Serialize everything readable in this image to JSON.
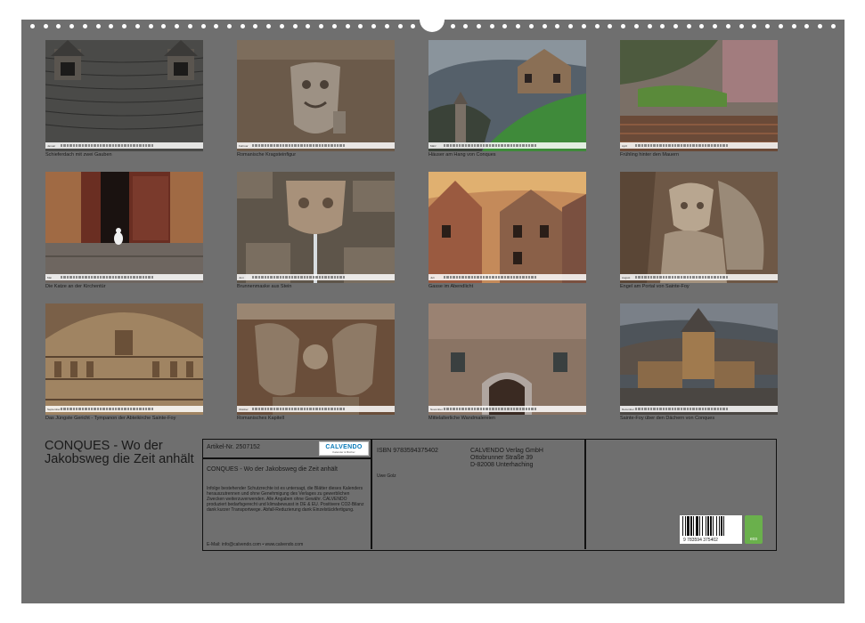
{
  "calendar": {
    "title": "CONQUES - Wo der Jakobsweg die Zeit anhält"
  },
  "months": [
    {
      "caption": "Schieferdach mit zwei Gauben",
      "month": "Januar"
    },
    {
      "caption": "Romanische Kragsteinfigur",
      "month": "Februar"
    },
    {
      "caption": "Häuser am Hang von Conques",
      "month": "März"
    },
    {
      "caption": "Frühling hinter den Mauern",
      "month": "April"
    },
    {
      "caption": "Die Katze an der Kirchentür",
      "month": "Mai"
    },
    {
      "caption": "Brunnenmaske aus Stein",
      "month": "Juni"
    },
    {
      "caption": "Gasse im Abendlicht",
      "month": "Juli"
    },
    {
      "caption": "Engel am Portal von Sainte-Foy",
      "month": "August"
    },
    {
      "caption": "Das Jüngste Gericht - Tympanon der Abteikirche Sainte-Foy",
      "month": "September"
    },
    {
      "caption": "Romanisches Kapitell",
      "month": "Oktober"
    },
    {
      "caption": "Mittelalterliche Wandmalereien",
      "month": "November"
    },
    {
      "caption": "Sainte-Foy über den Dächern von Conques",
      "month": "Dezember"
    }
  ],
  "info": {
    "article": "Artikel-Nr. 2507152",
    "logo_name": "CALVENDO",
    "logo_sub": "Kalender & Bücher",
    "panel_title": "CONQUES - Wo der Jakobsweg die Zeit anhält",
    "legal": "Infolge bestehender Schutzrechte ist es untersagt, die Blätter dieses Kalenders herauszutrennen und ohne Genehmigung des Verlages zu gewerblichen Zwecken weiterzuverwenden. Alle Angaben ohne Gewähr. CALVENDO produziert bedarfsgerecht und klimabewusst in DE & EU. Positivere CO2-Bilanz dank kurzer Transportwege. Abfall-Reduzierung dank Einzelstückfertigung.",
    "email": "E-Mail: info@calvendo.com • www.calvendo.com",
    "isbn": "ISBN 9783594375402",
    "author": "Uwe Golz",
    "publisher_1": "CALVENDO Verlag GmbH",
    "publisher_2": "Ottobrunner Straße 39",
    "publisher_3": "D-82008 Unterhaching",
    "barcode_digits": "9 783594 375402",
    "eco_label": "eco"
  },
  "colors": {
    "sheet": "#6f6f6f",
    "accent": "#0a7ab8",
    "eco": "#6ab04c"
  }
}
